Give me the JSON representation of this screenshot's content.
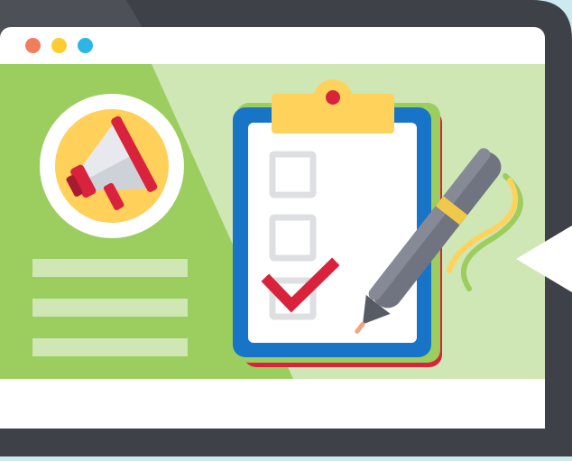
{
  "illustration": {
    "window_controls": [
      {
        "name": "close",
        "color": "#f07d5c"
      },
      {
        "name": "minimize",
        "color": "#ffcc2f"
      },
      {
        "name": "maximize",
        "color": "#2bb7e6"
      }
    ],
    "icons": [
      "megaphone-icon",
      "clipboard-icon",
      "checkbox-icon",
      "checkmark-icon",
      "pen-icon",
      "cursor-pointer-icon"
    ],
    "checklist": [
      {
        "checked": false
      },
      {
        "checked": false
      },
      {
        "checked": true
      }
    ],
    "colors": {
      "background": "#cfe9f1",
      "device_frame": "#3f4148",
      "window_chrome": "#ffffff",
      "panel_green_dark": "#9ccd5f",
      "panel_green_light": "#cfe6b5",
      "clipboard_blue": "#1774c7",
      "clip_yellow": "#ffd35b",
      "check_red": "#d9233c",
      "pen_gray": "#6f7480",
      "pen_band": "#f1c94a"
    }
  }
}
